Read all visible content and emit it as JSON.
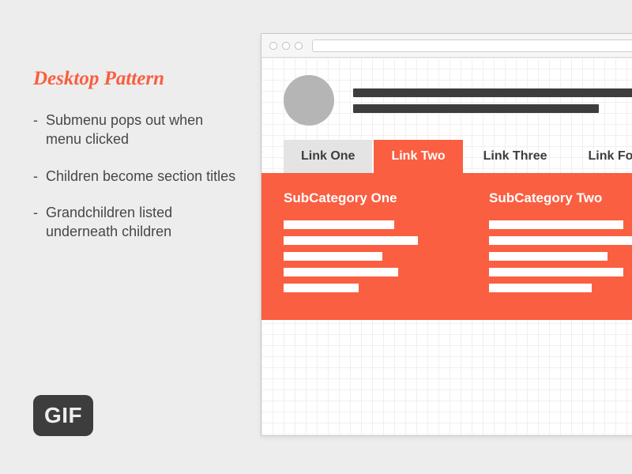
{
  "left": {
    "title": "Desktop Pattern",
    "bullets": [
      "Submenu pops out when menu clicked",
      "Children become section titles",
      "Grandchildren listed underneath children"
    ]
  },
  "gif_label": "GIF",
  "nav": {
    "tabs": [
      "Link One",
      "Link Two",
      "Link Three",
      "Link Four"
    ],
    "active_index": 1
  },
  "mega": {
    "columns": [
      {
        "title": "SubCategory One"
      },
      {
        "title": "SubCategory Two"
      }
    ]
  }
}
